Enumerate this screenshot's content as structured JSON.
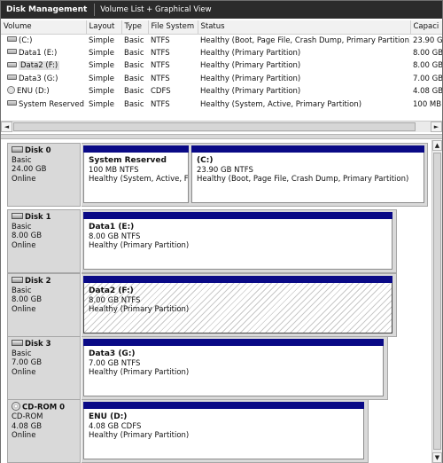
{
  "title": {
    "app": "Disk Management",
    "view": "Volume List + Graphical View"
  },
  "volume_table": {
    "columns": [
      "Volume",
      "Layout",
      "Type",
      "File System",
      "Status",
      "Capaci"
    ],
    "rows": [
      {
        "volume": "(C:)",
        "layout": "Simple",
        "type": "Basic",
        "fs": "NTFS",
        "status": "Healthy (Boot, Page File, Crash Dump, Primary Partition)",
        "capacity": "23.90 G",
        "icon": "hard-drive-icon"
      },
      {
        "volume": "Data1 (E:)",
        "layout": "Simple",
        "type": "Basic",
        "fs": "NTFS",
        "status": "Healthy (Primary Partition)",
        "capacity": "8.00 GB",
        "icon": "hard-drive-icon"
      },
      {
        "volume": "Data2 (F:)",
        "layout": "Simple",
        "type": "Basic",
        "fs": "NTFS",
        "status": "Healthy (Primary Partition)",
        "capacity": "8.00 GB",
        "icon": "hard-drive-icon"
      },
      {
        "volume": "Data3 (G:)",
        "layout": "Simple",
        "type": "Basic",
        "fs": "NTFS",
        "status": "Healthy (Primary Partition)",
        "capacity": "7.00 GB",
        "icon": "hard-drive-icon"
      },
      {
        "volume": "ENU (D:)",
        "layout": "Simple",
        "type": "Basic",
        "fs": "CDFS",
        "status": "Healthy (Primary Partition)",
        "capacity": "4.08 GB",
        "icon": "cd-drive-icon"
      },
      {
        "volume": "System Reserved",
        "layout": "Simple",
        "type": "Basic",
        "fs": "NTFS",
        "status": "Healthy (System, Active, Primary Partition)",
        "capacity": "100 MB",
        "icon": "hard-drive-icon"
      }
    ]
  },
  "scroll": {
    "left": "◄",
    "right": "►",
    "up": "▲",
    "down": "▼"
  },
  "disks": [
    {
      "name": "Disk 0",
      "kind": "Basic",
      "size": "24.00 GB",
      "state": "Online",
      "partitions": [
        {
          "name": "System Reserved",
          "size": "100 MB NTFS",
          "status": "Healthy (System, Active, F"
        },
        {
          "name": "(C:)",
          "size": "23.90 GB NTFS",
          "status": "Healthy (Boot, Page File, Crash Dump, Primary Partition)"
        }
      ]
    },
    {
      "name": "Disk 1",
      "kind": "Basic",
      "size": "8.00 GB",
      "state": "Online",
      "partitions": [
        {
          "name": "Data1  (E:)",
          "size": "8.00 GB NTFS",
          "status": "Healthy (Primary Partition)"
        }
      ]
    },
    {
      "name": "Disk 2",
      "kind": "Basic",
      "size": "8.00 GB",
      "state": "Online",
      "partitions": [
        {
          "name": "Data2  (F:)",
          "size": "8.00 GB NTFS",
          "status": "Healthy (Primary Partition)"
        }
      ]
    },
    {
      "name": "Disk 3",
      "kind": "Basic",
      "size": "7.00 GB",
      "state": "Online",
      "partitions": [
        {
          "name": "Data3  (G:)",
          "size": "7.00 GB NTFS",
          "status": "Healthy (Primary Partition)"
        }
      ]
    },
    {
      "name": "CD-ROM 0",
      "kind": "CD-ROM",
      "size": "4.08 GB",
      "state": "Online",
      "partitions": [
        {
          "name": "ENU  (D:)",
          "size": "4.08 GB CDFS",
          "status": "Healthy (Primary Partition)"
        }
      ]
    }
  ]
}
